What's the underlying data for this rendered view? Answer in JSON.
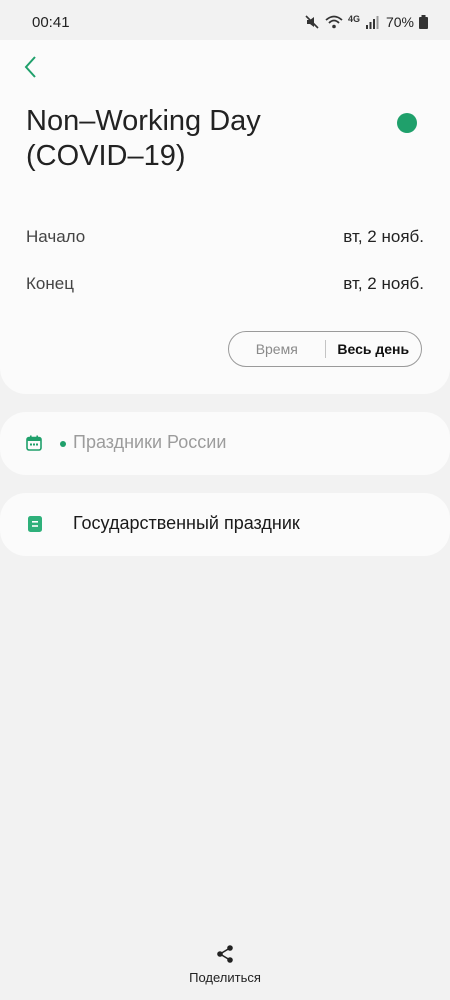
{
  "status_bar": {
    "time": "00:41",
    "network": "4G",
    "battery": "70%"
  },
  "event": {
    "title": "Non–Working Day (COVID–19)",
    "color": "#1fa06b",
    "start_label": "Начало",
    "start_value": "вт, 2 нояб.",
    "end_label": "Конец",
    "end_value": "вт, 2 нояб.",
    "toggle_time": "Время",
    "toggle_all_day": "Весь день",
    "all_day_selected": true
  },
  "calendar": {
    "icon": "calendar-icon",
    "name": "Праздники России",
    "color": "#1fa06b"
  },
  "note": {
    "icon": "note-icon",
    "text": "Государственный праздник"
  },
  "footer": {
    "share_icon": "share-icon",
    "share_label": "Поделиться"
  },
  "colors": {
    "accent": "#1fa06b",
    "background": "#f2f2f2",
    "card": "#fbfbfb"
  }
}
